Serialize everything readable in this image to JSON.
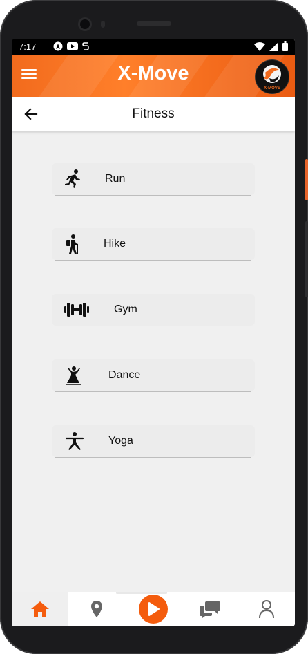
{
  "status_bar": {
    "time": "7:17"
  },
  "app_bar": {
    "title": "X-Move",
    "brand_color": "#f26b1d",
    "logo_text": "X-MOVE"
  },
  "page": {
    "title": "Fitness"
  },
  "activities": [
    {
      "label": "Run",
      "icon": "run-icon"
    },
    {
      "label": "Hike",
      "icon": "hike-icon"
    },
    {
      "label": "Gym",
      "icon": "dumbbell-icon"
    },
    {
      "label": "Dance",
      "icon": "dance-icon"
    },
    {
      "label": "Yoga",
      "icon": "yoga-icon"
    }
  ],
  "bottom_nav": [
    {
      "name": "home",
      "icon": "home-icon",
      "active": true
    },
    {
      "name": "location",
      "icon": "location-pin-icon",
      "active": false
    },
    {
      "name": "play",
      "icon": "play-icon",
      "active": false
    },
    {
      "name": "chat",
      "icon": "chat-icon",
      "active": false
    },
    {
      "name": "profile",
      "icon": "person-icon",
      "active": false
    }
  ]
}
